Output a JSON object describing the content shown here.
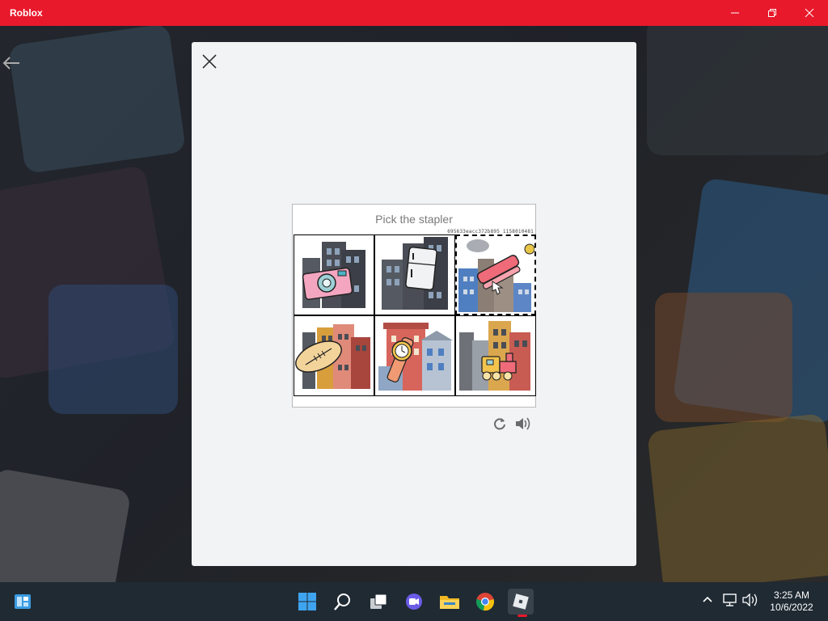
{
  "window": {
    "title": "Roblox"
  },
  "captcha": {
    "prompt": "Pick the stapler",
    "code": "695633eacc372b895 1158010481",
    "tiles": [
      {
        "name": "camera",
        "selected": false
      },
      {
        "name": "refrigerator",
        "selected": false
      },
      {
        "name": "stapler",
        "selected": true
      },
      {
        "name": "football",
        "selected": false
      },
      {
        "name": "wristwatch",
        "selected": false
      },
      {
        "name": "toy-train",
        "selected": false
      }
    ]
  },
  "taskbar": {
    "time": "3:25 AM",
    "date": "10/6/2022",
    "pinned": [
      "windows-start-icon",
      "search-icon",
      "task-view-icon",
      "chat-icon",
      "file-explorer-icon",
      "chrome-icon",
      "roblox-icon"
    ]
  },
  "colors": {
    "titlebar": "#e8192b",
    "taskbar": "#1f2a33",
    "modal": "#f2f3f4"
  }
}
